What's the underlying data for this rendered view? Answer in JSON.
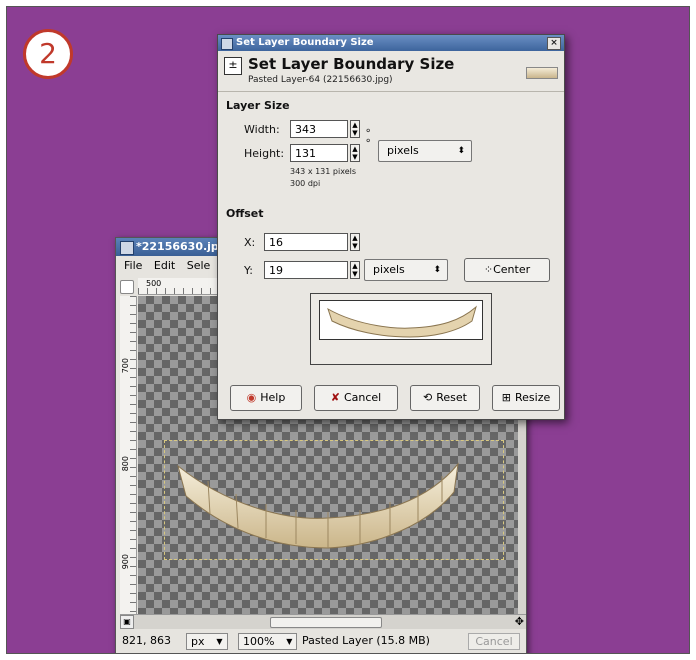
{
  "step_number": "2",
  "image_window": {
    "title": "*22156630.jpg-",
    "menu": [
      "File",
      "Edit",
      "Sele"
    ],
    "ruler_top_label": "500",
    "ruler_left_labels": [
      "700",
      "800",
      "900"
    ],
    "status": {
      "coords": "821, 863",
      "unit": "px",
      "zoom": "100%",
      "layer_info": "Pasted Layer (15.8 MB)",
      "cancel": "Cancel"
    }
  },
  "dialog": {
    "window_title": "Set Layer Boundary Size",
    "close_glyph": "×",
    "header_title": "Set Layer Boundary Size",
    "header_subtitle": "Pasted Layer-64 (22156630.jpg)",
    "layer_size": {
      "section_label": "Layer Size",
      "width_label": "Width:",
      "width_value": "343",
      "height_label": "Height:",
      "height_value": "131",
      "unit": "pixels",
      "dimensions_info": "343 x 131 pixels",
      "dpi_info": "300 dpi"
    },
    "offset": {
      "section_label": "Offset",
      "x_label": "X:",
      "x_value": "16",
      "y_label": "Y:",
      "y_value": "19",
      "unit": "pixels",
      "center_label": "Center"
    },
    "buttons": {
      "help": "Help",
      "cancel": "Cancel",
      "reset": "Reset",
      "resize": "Resize"
    }
  },
  "colors": {
    "background": "#8b3e93",
    "badge_border": "#c0392b",
    "titlebar": "#4a72aa"
  }
}
